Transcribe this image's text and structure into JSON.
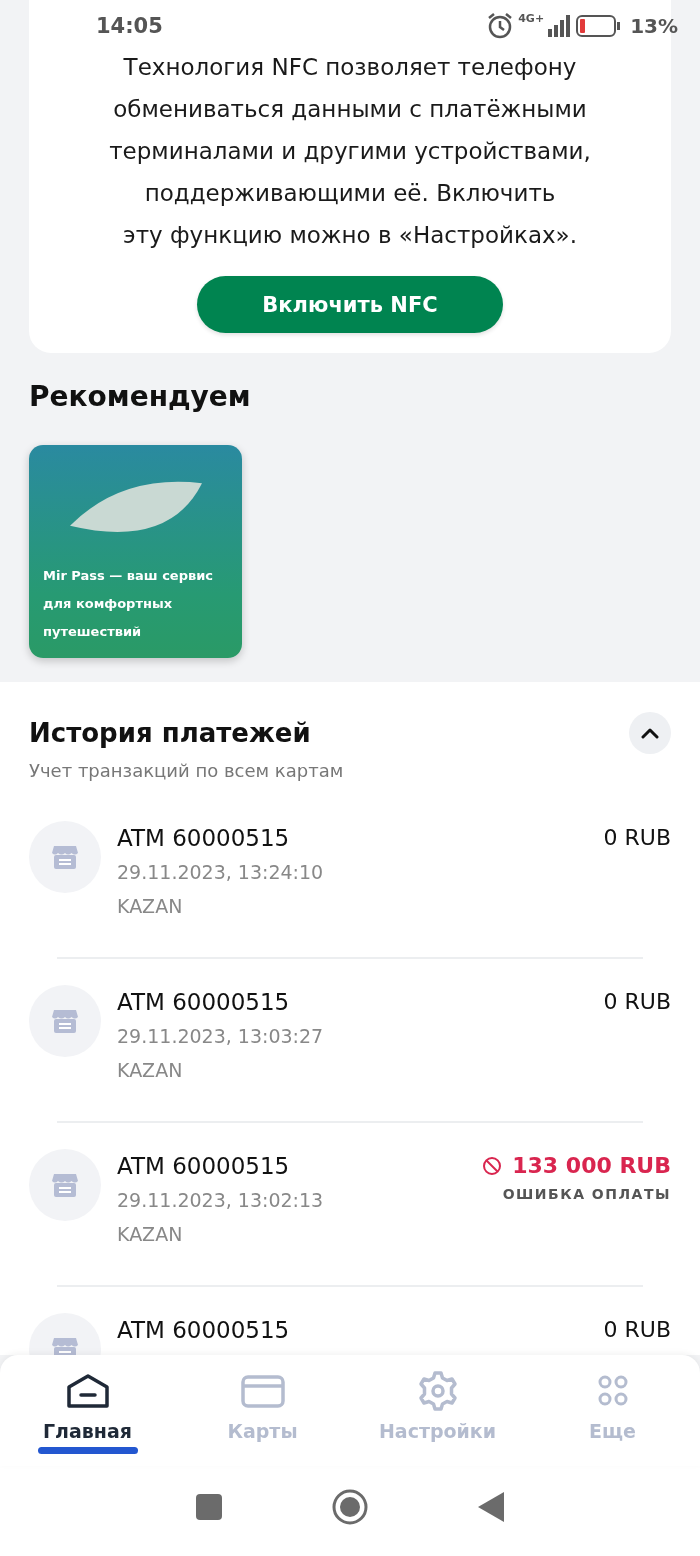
{
  "status_bar": {
    "time": "14:05",
    "network": "4G+",
    "battery": "13%"
  },
  "nfc_card": {
    "text": "Технология NFC позволяет телефону обмениваться данными с платёжными терминалами и другими устройствами, поддерживающими её. Включить\nэту функцию можно в «Настройках».",
    "button": "Включить NFC"
  },
  "recommended": {
    "title": "Рекомендуем",
    "cards": [
      {
        "text": "Mir Pass — ваш сервис для комфортных путешествий"
      }
    ]
  },
  "history": {
    "title": "История платежей",
    "subtitle": "Учет транзакций по всем картам",
    "expanded": true,
    "transactions": [
      {
        "kind": "ok",
        "title": "ATM 60000515",
        "date": "29.11.2023, 13:24:10",
        "city": "KAZAN",
        "amount": "0 RUB"
      },
      {
        "kind": "ok",
        "title": "ATM 60000515",
        "date": "29.11.2023, 13:03:27",
        "city": "KAZAN",
        "amount": "0 RUB"
      },
      {
        "kind": "failed",
        "title": "ATM 60000515",
        "date": "29.11.2023, 13:02:13",
        "city": "KAZAN",
        "amount": "133 000 RUB",
        "status": "ОШИБКА ОПЛАТЫ"
      },
      {
        "kind": "ok",
        "title": "ATM 60000515",
        "amount": "0 RUB"
      }
    ]
  },
  "tabs": [
    {
      "kind": "home",
      "label": "Главная",
      "selected": true
    },
    {
      "kind": "card",
      "label": "Карты",
      "selected": false
    },
    {
      "kind": "settings",
      "label": "Настройки",
      "selected": false
    },
    {
      "kind": "more",
      "label": "Еще",
      "selected": false
    }
  ]
}
